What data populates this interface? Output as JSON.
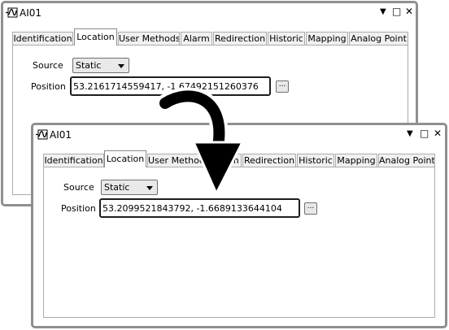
{
  "back_window": {
    "title": "AI01",
    "controls": {
      "dropdown": "▼",
      "maximize": "□",
      "close": "✕"
    },
    "tabs": [
      "Identification",
      "Location",
      "User Methods",
      "Alarm",
      "Redirection",
      "Historic",
      "Mapping",
      "Analog Point"
    ],
    "active_tab": "Location",
    "source_label": "Source",
    "source_value": "Static",
    "position_label": "Position",
    "position_value": "53.2161714559417, -1.67492151260376",
    "browse_label": "..."
  },
  "front_window": {
    "title": "AI01",
    "controls": {
      "dropdown": "▼",
      "maximize": "□",
      "close": "✕"
    },
    "tabs": [
      "Identification",
      "Location",
      "User Methods",
      "Alarm",
      "Redirection",
      "Historic",
      "Mapping",
      "Analog Point"
    ],
    "active_tab": "Location",
    "source_label": "Source",
    "source_value": "Static",
    "position_label": "Position",
    "position_value": "53.2099521843792, -1.6689133644104",
    "browse_label": "..."
  },
  "colors": {
    "window_border": "#8f8f8f",
    "arrow": "#000000",
    "field_border": "#1e1e1e"
  }
}
